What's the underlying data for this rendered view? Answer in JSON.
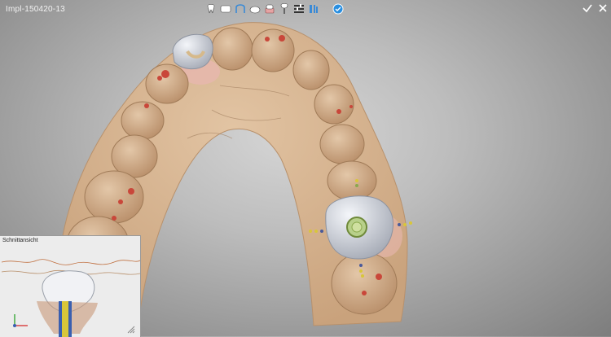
{
  "window": {
    "title": "Impl-150420-13"
  },
  "toolbar": {
    "items": [
      {
        "icon": "tooth-icon"
      },
      {
        "icon": "model-icon"
      },
      {
        "icon": "arch-icon"
      },
      {
        "icon": "gingiva-icon"
      },
      {
        "icon": "crown-icon"
      },
      {
        "icon": "implant-icon"
      },
      {
        "icon": "settings-sliders-icon"
      },
      {
        "icon": "scanbody-icon"
      },
      {
        "icon": "confirm-circle-icon"
      }
    ]
  },
  "actions": {
    "confirm_icon": "check-icon",
    "close_icon": "close-icon"
  },
  "section_view": {
    "title": "Schnittansicht"
  },
  "colors": {
    "model": "#d8b896",
    "marking": "#c9473a",
    "crown": "#c8ccd4",
    "accent": "#2a8fe0"
  }
}
